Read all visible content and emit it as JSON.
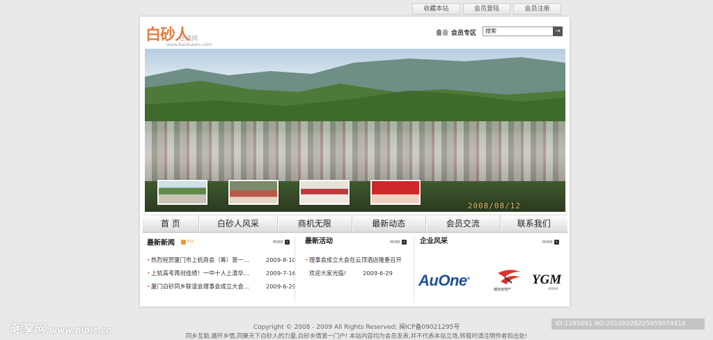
{
  "topbar": {
    "links": [
      "收藏本站",
      "会员登陆",
      "会员注册"
    ]
  },
  "header": {
    "logo_text": "白砂人",
    "logo_sub": "在线网",
    "logo_url": "www.baishaxm.com",
    "member_area": "会员专区",
    "search_value": "搜索",
    "search_button": "→"
  },
  "banner": {
    "date_stamp": "2008/08/12"
  },
  "nav": {
    "items": [
      "首 页",
      "白砂人风采",
      "商机无限",
      "最新动态",
      "会员交流",
      "联系我们"
    ]
  },
  "news": {
    "title": "最新新闻",
    "rss": "RSS",
    "more": "MORE",
    "items": [
      {
        "title": "热烈祝贺厦门市上杭商会（筹）第一...",
        "date": "2009-8-10"
      },
      {
        "title": "上杭高考再创佳绩！一中十人上清华...",
        "date": "2009-7-16"
      },
      {
        "title": "厦门白砂同乡联谊会理事会成立大会...",
        "date": "2009-6-29"
      }
    ]
  },
  "activity": {
    "title": "最新活动",
    "more": "MORE",
    "line1": "理事会成立大会在云顶酒店隆重召开",
    "line2": "欢迎大家光临!",
    "date": "2009-6-29"
  },
  "company": {
    "title": "企业风采",
    "more": "MORE",
    "logo1": "AuOne",
    "logo1_mark": "®",
    "logo2_text": "瑞安房地产",
    "logo3": "YGM",
    "logo3_sub": "GROUP"
  },
  "footer": {
    "copyright": "Copyright © 2008 - 2009 All Rights Reserved; 闽ICP备09021295号",
    "note": "同乡互助,痛怀乡情,同聚天下白砂人的力量,白砂乡情第一门户! 本站内容均为会员发表,并不代表本站立场,转载时请注明作者和出处!"
  },
  "watermark": {
    "brand": "昵享网",
    "site": "www.nipic.cn",
    "id": "ID:1295091 NO:20100328225959074414"
  },
  "colors": {
    "accent": "#e47d3a",
    "auone_blue": "#1b4f9a"
  }
}
